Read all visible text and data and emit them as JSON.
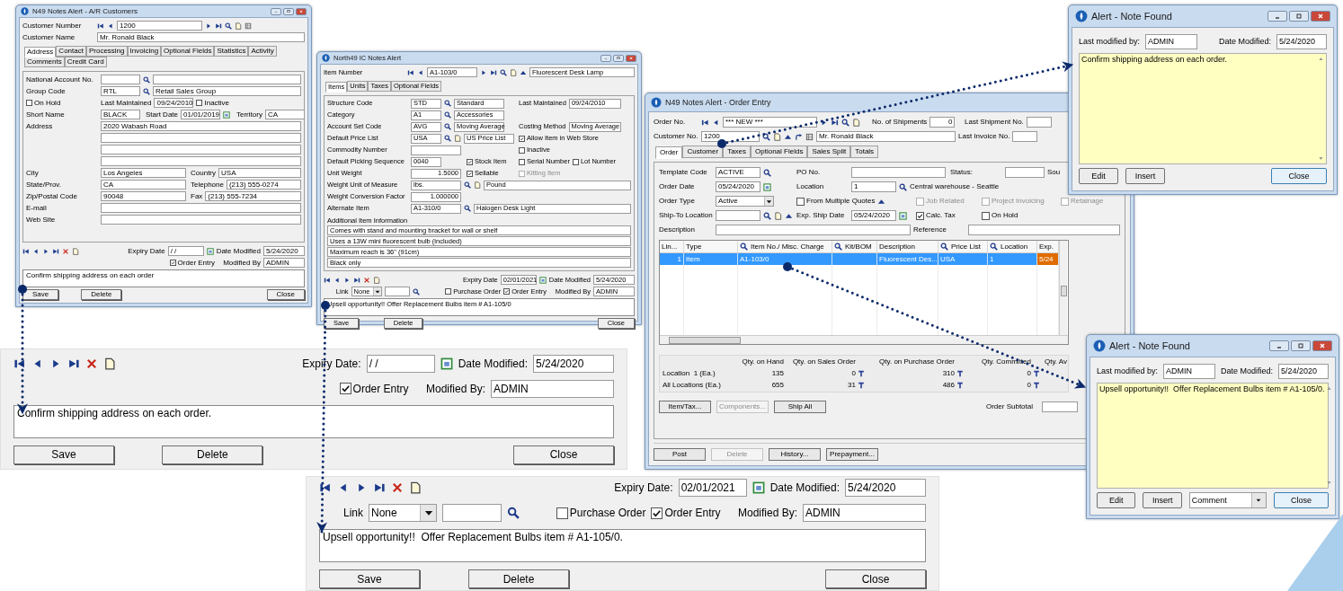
{
  "customers_window": {
    "title": "N49 Notes Alert - A/R Customers",
    "header_rows": [
      [
        [
          {
            "kind": "label",
            "text": "Customer Number"
          },
          {
            "kind": "first"
          },
          {
            "kind": "prev"
          },
          {
            "kind": "mid",
            "value": "1200"
          },
          {
            "kind": "next"
          },
          {
            "kind": "last"
          },
          {
            "kind": "search"
          },
          {
            "kind": "doc"
          },
          {
            "kind": "grid"
          }
        ]
      ],
      [
        [
          {
            "kind": "label",
            "text": "Customer Name"
          },
          {
            "kind": "wide",
            "value": "Mr. Ronald Black"
          }
        ]
      ]
    ],
    "tabs": [
      {
        "label": "Address",
        "selected": true
      },
      {
        "label": "Contact",
        "selected": false
      },
      {
        "label": "Processing",
        "selected": false
      },
      {
        "label": "Invoicing",
        "selected": false
      },
      {
        "label": "Optional Fields",
        "selected": false
      },
      {
        "label": "Statistics",
        "selected": false
      },
      {
        "label": "Activity",
        "selected": false
      },
      {
        "label": "Comments",
        "selected": false
      },
      {
        "label": "Credit Card",
        "selected": false
      }
    ],
    "rows": [
      [
        [
          {
            "kind": "label",
            "text": "National Account No."
          },
          {
            "kind": "field"
          },
          {
            "kind": "search"
          },
          {
            "kind": "wide"
          }
        ]
      ],
      [
        [
          {
            "kind": "label",
            "text": "Group Code"
          },
          {
            "kind": "field",
            "value": "RTL"
          },
          {
            "kind": "search"
          },
          {
            "kind": "wide",
            "value": "Retail Sales Group"
          }
        ]
      ],
      [
        [
          {
            "kind": "check",
            "label": "On Hold",
            "checked": false,
            "disabled": false
          }
        ],
        [
          {
            "kind": "label",
            "text": "Last Maintained"
          },
          {
            "kind": "field",
            "value": "09/24/2010"
          },
          {
            "kind": "check",
            "label": "Inactive",
            "checked": false,
            "disabled": false
          }
        ]
      ],
      [
        [
          {
            "kind": "label",
            "text": "Short Name"
          },
          {
            "kind": "field",
            "value": "BLACK"
          }
        ],
        [
          {
            "kind": "label",
            "text": "Start Date"
          },
          {
            "kind": "field",
            "value": "01/01/2019"
          },
          {
            "kind": "calendar"
          }
        ],
        [
          {
            "kind": "label",
            "text": "Territory"
          },
          {
            "kind": "field",
            "value": "CA"
          }
        ]
      ],
      [
        [
          {
            "kind": "label",
            "text": "Address"
          },
          {
            "kind": "wide",
            "value": "2020 Wabash Road"
          }
        ]
      ],
      [
        [
          {
            "kind": "indent"
          },
          {
            "kind": "wide"
          }
        ]
      ],
      [
        [
          {
            "kind": "indent"
          },
          {
            "kind": "wide"
          }
        ]
      ],
      [
        [
          {
            "kind": "indent"
          },
          {
            "kind": "wide"
          }
        ]
      ],
      [
        [
          {
            "kind": "label",
            "text": "City"
          },
          {
            "kind": "mid",
            "value": "Los Angeles"
          }
        ],
        [
          {
            "kind": "label",
            "text": "Country"
          },
          {
            "kind": "wide",
            "value": "USA"
          }
        ]
      ],
      [
        [
          {
            "kind": "label",
            "text": "State/Prov."
          },
          {
            "kind": "mid",
            "value": "CA"
          }
        ],
        [
          {
            "kind": "label",
            "text": "Telephone"
          },
          {
            "kind": "wide",
            "value": "(213) 555-0274"
          }
        ]
      ],
      [
        [
          {
            "kind": "label",
            "text": "Zip/Postal Code"
          },
          {
            "kind": "mid",
            "value": "90048"
          }
        ],
        [
          {
            "kind": "label",
            "text": "Fax"
          },
          {
            "kind": "wide",
            "value": "(213) 555-7234"
          }
        ]
      ],
      [
        [
          {
            "kind": "label",
            "text": "E-mail"
          },
          {
            "kind": "wide"
          }
        ]
      ],
      [
        [
          {
            "kind": "label",
            "text": "Web Site"
          },
          {
            "kind": "wide"
          }
        ]
      ]
    ],
    "notes": {
      "expiry_label": "Expiry Date",
      "expiry": "/ /",
      "modified_label": "Date Modified",
      "date_modified": "5/24/2020",
      "checks": [
        {
          "label": "Order Entry",
          "checked": true
        }
      ],
      "modified_by_label": "Modified By",
      "modified_by": "ADMIN",
      "note": "Confirm shipping address on each order",
      "buttons": [
        {
          "label": "Save"
        },
        {
          "label": "Delete"
        },
        {
          "label": "Close"
        }
      ]
    }
  },
  "items_window": {
    "title": "North49 IC Notes Alert",
    "header_rows": [
      [
        [
          {
            "kind": "label",
            "text": "Item Number"
          },
          {
            "kind": "first"
          },
          {
            "kind": "prev"
          },
          {
            "kind": "mid",
            "value": "A1-103/0"
          },
          {
            "kind": "next"
          },
          {
            "kind": "last"
          },
          {
            "kind": "search"
          },
          {
            "kind": "doc"
          },
          {
            "kind": "up"
          },
          {
            "kind": "wide",
            "value": "Fluorescent Desk Lamp"
          }
        ]
      ]
    ],
    "tabs": [
      {
        "label": "Items",
        "selected": true
      },
      {
        "label": "Units",
        "selected": false
      },
      {
        "label": "Taxes",
        "selected": false
      },
      {
        "label": "Optional Fields",
        "selected": false
      }
    ],
    "rows": [
      [
        [
          {
            "kind": "label",
            "text": "Structure Code"
          },
          {
            "kind": "field",
            "value": "STD"
          },
          {
            "kind": "search"
          },
          {
            "kind": "mid",
            "value": "Standard"
          }
        ],
        [
          {
            "kind": "label",
            "text": "Last Maintained"
          },
          {
            "kind": "long",
            "value": "09/24/2010"
          }
        ]
      ],
      [
        [
          {
            "kind": "label",
            "text": "Category"
          },
          {
            "kind": "field",
            "value": "A1"
          },
          {
            "kind": "search"
          },
          {
            "kind": "mid",
            "value": "Accessories"
          }
        ]
      ],
      [
        [
          {
            "kind": "label",
            "text": "Account Set Code"
          },
          {
            "kind": "field",
            "value": "AVG"
          },
          {
            "kind": "search"
          },
          {
            "kind": "mid",
            "value": "Moving Average"
          }
        ],
        [
          {
            "kind": "label",
            "text": "Costing Method"
          },
          {
            "kind": "long",
            "value": "Moving Average"
          }
        ]
      ],
      [
        [
          {
            "kind": "label",
            "text": "Default Price List"
          },
          {
            "kind": "field",
            "value": "USA"
          },
          {
            "kind": "search"
          },
          {
            "kind": "doc"
          },
          {
            "kind": "mid",
            "value": "US Price List"
          }
        ],
        [
          {
            "kind": "check",
            "label": "Allow Item in Web Store",
            "checked": true,
            "disabled": false
          }
        ]
      ],
      [
        [
          {
            "kind": "label",
            "text": "Commodity Number"
          },
          {
            "kind": "mid"
          }
        ],
        [
          {
            "kind": "check",
            "label": "Inactive",
            "checked": false,
            "disabled": false
          }
        ]
      ],
      [
        [
          {
            "kind": "label",
            "text": "Default Picking Sequence"
          },
          {
            "kind": "field",
            "value": "0040"
          }
        ],
        [
          {
            "kind": "check",
            "label": "Stock Item",
            "checked": true,
            "disabled": false
          }
        ],
        [
          {
            "kind": "check",
            "label": "Serial Number",
            "checked": false,
            "disabled": false
          },
          {
            "kind": "check",
            "label": "Lot Number",
            "checked": false,
            "disabled": false
          }
        ]
      ],
      [
        [
          {
            "kind": "label",
            "text": "Unit Weight"
          },
          {
            "kind": "midnum",
            "value": "1.5000"
          }
        ],
        [
          {
            "kind": "check",
            "label": "Sellable",
            "checked": true,
            "disabled": false
          }
        ],
        [
          {
            "kind": "check",
            "label": "Kitting Item",
            "checked": false,
            "disabled": true
          }
        ]
      ],
      [
        [
          {
            "kind": "label",
            "text": "Weight Unit of Measure"
          },
          {
            "kind": "mid",
            "value": "lbs."
          },
          {
            "kind": "search"
          },
          {
            "kind": "doc"
          },
          {
            "kind": "wide",
            "value": "Pound"
          }
        ]
      ],
      [
        [
          {
            "kind": "label",
            "text": "Weight Conversion Factor"
          },
          {
            "kind": "midnum",
            "value": "1.000000"
          }
        ]
      ],
      [
        [
          {
            "kind": "label",
            "text": "Alternate Item"
          },
          {
            "kind": "mid",
            "value": "A1-310/0"
          },
          {
            "kind": "search"
          },
          {
            "kind": "wide",
            "value": "Halogen Desk Light"
          }
        ]
      ]
    ],
    "info_label": "Additional Item Information",
    "info_lines": [
      "Comes with stand and mounting bracket for wall or shelf",
      "Uses a 13W mini fluorescent bulb (included)",
      "Maximum reach is 36\" (91cm)",
      "Black only"
    ],
    "notes": {
      "expiry_label": "Expiry Date",
      "expiry": "02/01/2021",
      "modified_label": "Date Modified",
      "date_modified": "5/24/2020",
      "link": {
        "label": "Link",
        "value": "None"
      },
      "checks": [
        {
          "label": "Purchase Order",
          "checked": false
        },
        {
          "label": "Order Entry",
          "checked": true
        }
      ],
      "modified_by_label": "Modified By",
      "modified_by": "ADMIN",
      "note": "Upsell opportunity!! Offer Replacement Bulbs item # A1-105/0",
      "buttons": [
        {
          "label": "Save"
        },
        {
          "label": "Delete"
        },
        {
          "label": "Close"
        }
      ]
    }
  },
  "order_window": {
    "title": "N49 Notes Alert - Order Entry",
    "header_rows": [
      [
        [
          {
            "kind": "label",
            "text": "Order No."
          },
          {
            "kind": "first"
          },
          {
            "kind": "prev"
          },
          {
            "kind": "long",
            "value": "*** NEW ***"
          },
          {
            "kind": "next"
          },
          {
            "kind": "last"
          },
          {
            "kind": "search"
          },
          {
            "kind": "doc"
          }
        ],
        [
          {
            "kind": "label",
            "text": "No. of Shipments"
          },
          {
            "kind": "tiny",
            "value": "0"
          }
        ],
        [
          {
            "kind": "label",
            "text": "Last Shipment No."
          },
          {
            "kind": "tiny"
          }
        ]
      ],
      [
        [
          {
            "kind": "label",
            "text": "Customer No."
          },
          {
            "kind": "mid",
            "value": "1200"
          },
          {
            "kind": "search"
          },
          {
            "kind": "doc"
          },
          {
            "kind": "up"
          },
          {
            "kind": "curve"
          },
          {
            "kind": "grid"
          },
          {
            "kind": "wide",
            "value": "Mr. Ronald Black"
          }
        ],
        [
          {
            "kind": "label",
            "text": "Last Invoice No."
          },
          {
            "kind": "tiny"
          }
        ]
      ]
    ],
    "tabs": [
      {
        "label": "Order",
        "selected": true
      },
      {
        "label": "Customer",
        "selected": false
      },
      {
        "label": "Taxes",
        "selected": false
      },
      {
        "label": "Optional Fields",
        "selected": false
      },
      {
        "label": "Sales Split",
        "selected": false
      },
      {
        "label": "Totals",
        "selected": false
      }
    ],
    "rows": [
      [
        [
          {
            "kind": "label",
            "text": "Template Code"
          },
          {
            "kind": "field",
            "value": "ACTIVE"
          },
          {
            "kind": "search"
          }
        ],
        [
          {
            "kind": "label",
            "text": "PO No."
          },
          {
            "kind": "long"
          }
        ],
        [
          {
            "kind": "label",
            "text": "Status:"
          },
          {
            "kind": "wide"
          }
        ],
        [
          {
            "kind": "text",
            "text": "Sou"
          }
        ]
      ],
      [
        [
          {
            "kind": "label",
            "text": "Order Date"
          },
          {
            "kind": "field",
            "value": "05/24/2020"
          },
          {
            "kind": "calendar"
          }
        ],
        [
          {
            "kind": "label",
            "text": "Location"
          },
          {
            "kind": "field",
            "value": "1"
          },
          {
            "kind": "search"
          },
          {
            "kind": "text",
            "text": "Central warehouse - Seattle"
          }
        ]
      ],
      [
        [
          {
            "kind": "label",
            "text": "Order Type"
          },
          {
            "kind": "select",
            "value": "Active"
          }
        ],
        [
          {
            "kind": "check",
            "label": "From Multiple Quotes",
            "checked": false,
            "disabled": false
          },
          {
            "kind": "up"
          }
        ],
        [
          {
            "kind": "check",
            "label": "Job Related",
            "checked": false,
            "disabled": true
          }
        ],
        [
          {
            "kind": "check",
            "label": "Project Invoicing",
            "checked": false,
            "disabled": true
          }
        ],
        [
          {
            "kind": "check",
            "label": "Retainage",
            "checked": false,
            "disabled": true
          }
        ]
      ],
      [
        [
          {
            "kind": "label",
            "text": "Ship-To Location"
          },
          {
            "kind": "field"
          },
          {
            "kind": "search"
          },
          {
            "kind": "doc"
          },
          {
            "kind": "up"
          }
        ],
        [
          {
            "kind": "label",
            "text": "Exp. Ship Date"
          },
          {
            "kind": "field",
            "value": "05/24/2020"
          },
          {
            "kind": "calendar"
          }
        ],
        [
          {
            "kind": "check",
            "label": "Calc. Tax",
            "checked": true,
            "disabled": false
          }
        ],
        [
          {
            "kind": "check",
            "label": "On Hold",
            "checked": false,
            "disabled": false
          }
        ]
      ],
      [
        [
          {
            "kind": "label",
            "text": "Description"
          },
          {
            "kind": "wide"
          }
        ],
        [
          {
            "kind": "label",
            "text": "Reference"
          },
          {
            "kind": "wide"
          }
        ]
      ]
    ],
    "grid": {
      "columns": [
        {
          "label": "Lin...",
          "lookup": false
        },
        {
          "label": "Type",
          "lookup": false
        },
        {
          "label": "Item No./ Misc. Charge",
          "lookup": true
        },
        {
          "label": "Kit/BOM",
          "lookup": true
        },
        {
          "label": "Description",
          "lookup": false
        },
        {
          "label": "Price List",
          "lookup": true
        },
        {
          "label": "Location",
          "lookup": true
        },
        {
          "label": "Exp.",
          "lookup": false
        }
      ],
      "rows": [
        {
          "selected": true,
          "line": "1",
          "type": "Item",
          "item_no": "A1-103/0",
          "description": "Fluorescent Des...",
          "price_list": "USA",
          "location": "1",
          "exp": "5/24"
        }
      ]
    },
    "quantities": {
      "columns": [
        {
          "label": "Qty. on Hand",
          "drill": false
        },
        {
          "label": "Qty. on Sales Order",
          "drill": true
        },
        {
          "label": "Qty. on Purchase Order",
          "drill": true
        },
        {
          "label": "Qty. Committed",
          "drill": true
        },
        {
          "label": "Qty. Av"
        }
      ],
      "rows": [
        {
          "label": "Location  1 (Ea.)",
          "values": [
            "135",
            "0",
            "310",
            "0"
          ]
        },
        {
          "label": "All Locations (Ea.)",
          "values": [
            "655",
            "31",
            "486",
            "0"
          ]
        }
      ]
    },
    "action_buttons": [
      {
        "label": "Item/Tax...",
        "disabled": false
      },
      {
        "label": "Components...",
        "disabled": true
      },
      {
        "label": "Ship All",
        "disabled": false
      }
    ],
    "subtotal_label": "Order Subtotal",
    "buttons": [
      {
        "label": "Post",
        "disabled": false
      },
      {
        "label": "Delete",
        "disabled": true
      },
      {
        "label": "History...",
        "disabled": false
      },
      {
        "label": "Prepayment...",
        "disabled": false
      }
    ]
  },
  "alerts": [
    {
      "title": "Alert - Note Found",
      "modified_by_label": "Last modified by:",
      "modified_by": "ADMIN",
      "date_label": "Date Modified:",
      "date_modified": "5/24/2020",
      "note": "Confirm shipping address on each order.",
      "buttons": [
        {
          "kind": "button",
          "label": "Edit",
          "default": false
        },
        {
          "kind": "button",
          "label": "Insert",
          "default": false
        },
        {
          "kind": "button",
          "label": "Close",
          "default": true
        }
      ]
    },
    {
      "title": "Alert - Note Found",
      "modified_by_label": "Last modified by:",
      "modified_by": "ADMIN",
      "date_label": "Date Modified:",
      "date_modified": "5/24/2020",
      "note": "Upsell opportunity!!  Offer Replacement Bulbs item # A1-105/0.",
      "buttons": [
        {
          "kind": "button",
          "label": "Edit",
          "default": false
        },
        {
          "kind": "button",
          "label": "Insert",
          "default": false
        },
        {
          "kind": "select",
          "value": "Comment"
        },
        {
          "kind": "button",
          "label": "Close",
          "default": true
        }
      ]
    }
  ],
  "zoom_panels": [
    {
      "expiry_label": "Expiry Date:",
      "expiry": "/ /",
      "modified_label": "Date Modified:",
      "date_modified": "5/24/2020",
      "checks": [
        {
          "label": "Order Entry",
          "checked": true
        }
      ],
      "modified_by_label": "Modified By:",
      "modified_by": "ADMIN",
      "note": "Confirm shipping address on each order.",
      "buttons": [
        {
          "label": "Save"
        },
        {
          "label": "Delete"
        },
        {
          "label": "Close"
        }
      ]
    },
    {
      "expiry_label": "Expiry Date:",
      "expiry": "02/01/2021",
      "modified_label": "Date Modified:",
      "date_modified": "5/24/2020",
      "link": {
        "label": "Link",
        "value": "None"
      },
      "checks": [
        {
          "label": "Purchase Order",
          "checked": false
        },
        {
          "label": "Order Entry",
          "checked": true
        }
      ],
      "modified_by_label": "Modified By:",
      "modified_by": "ADMIN",
      "note": "Upsell opportunity!!  Offer Replacement Bulbs item # A1-105/0.",
      "buttons": [
        {
          "label": "Save"
        },
        {
          "label": "Delete"
        },
        {
          "label": "Close"
        }
      ]
    }
  ]
}
